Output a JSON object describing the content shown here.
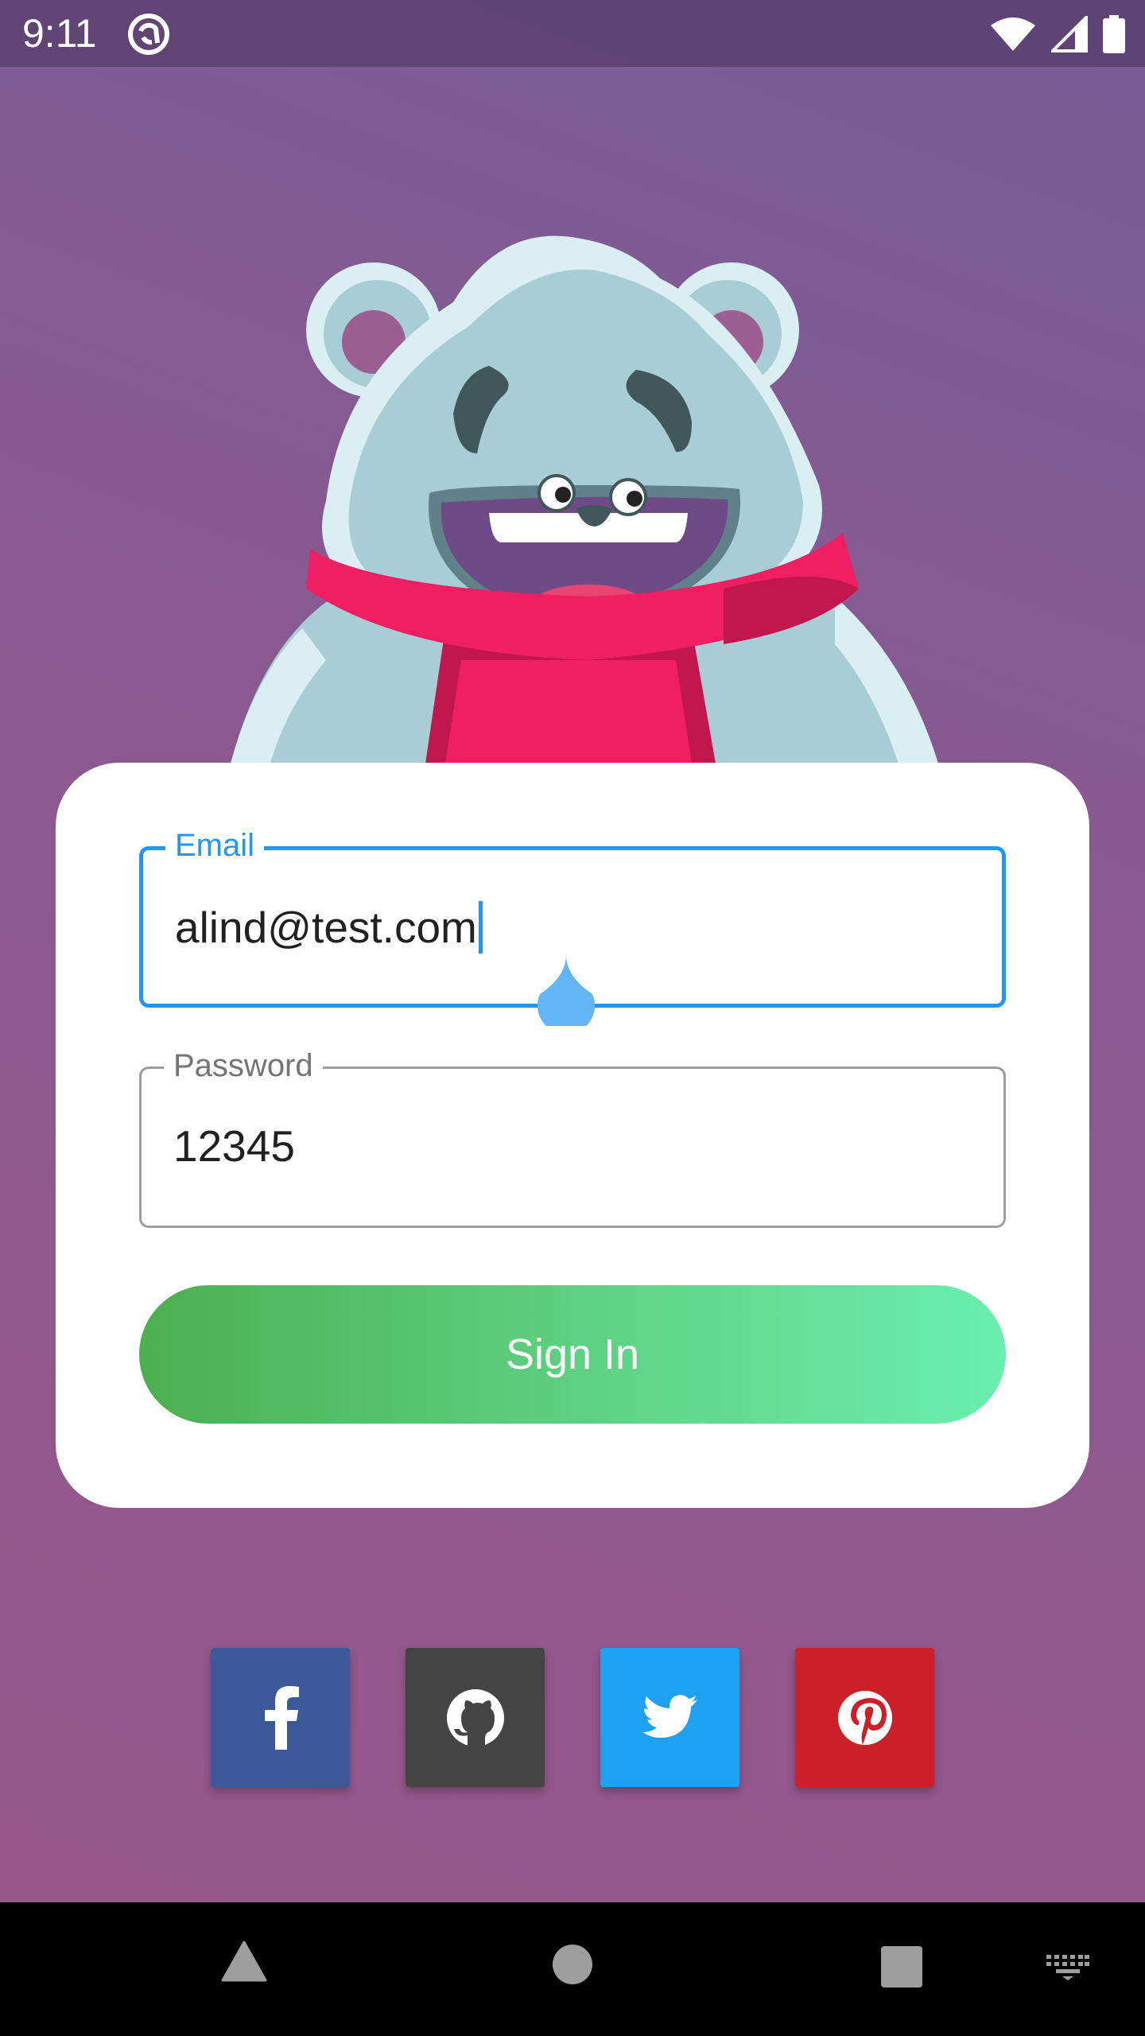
{
  "status_bar": {
    "time": "9:11",
    "icons": [
      "app-notification-icon",
      "wifi-icon",
      "signal-icon",
      "battery-icon"
    ]
  },
  "login_form": {
    "email": {
      "label": "Email",
      "value": "alind@test.com"
    },
    "password": {
      "label": "Password",
      "value": "12345"
    },
    "sign_in_label": "Sign In"
  },
  "social_buttons": [
    {
      "name": "facebook",
      "icon": "facebook-icon",
      "color": "#3b5998"
    },
    {
      "name": "github",
      "icon": "github-icon",
      "color": "#444444"
    },
    {
      "name": "twitter",
      "icon": "twitter-icon",
      "color": "#1da1f2"
    },
    {
      "name": "pinterest",
      "icon": "pinterest-icon",
      "color": "#cb2027"
    }
  ],
  "nav_bar": {
    "buttons": [
      "back-icon",
      "home-icon",
      "recents-icon",
      "keyboard-icon"
    ]
  },
  "colors": {
    "accent": "#2196f3",
    "button_gradient_start": "#4caf50",
    "button_gradient_end": "#6aefaf"
  }
}
